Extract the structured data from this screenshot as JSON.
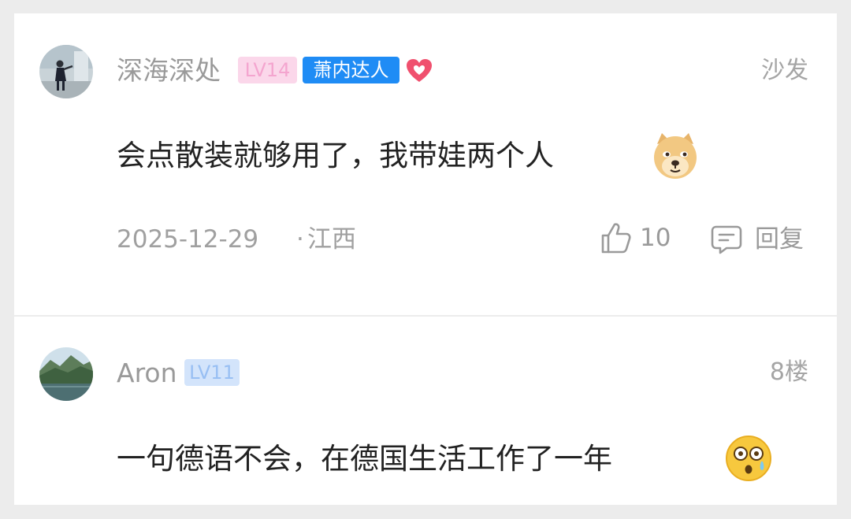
{
  "comments": [
    {
      "username": "深海深处",
      "level": "LV14",
      "tag": "萧内达人",
      "floor": "沙发",
      "text": "会点散装就够用了，我带娃两个人",
      "emoji_icon": "doge-emoji-icon",
      "date": "2025-12-29",
      "separator": "·",
      "location": "江西",
      "like_count": "10",
      "reply_label": "回复"
    },
    {
      "username": "Aron",
      "level": "LV11",
      "floor": "8楼",
      "text": "一句德语不会，在德国生活工作了一年",
      "emoji_icon": "shocked-face-emoji-icon"
    }
  ],
  "colors": {
    "background": "#ececec",
    "card": "#ffffff",
    "username": "#9a9a9a",
    "lv14_bg": "#fbd7ea",
    "lv14_text": "#f4a5cf",
    "lv11_bg": "#d3e4fb",
    "lv11_text": "#98bff3",
    "expert_badge": "#1f8cf5",
    "heart": "#f0506e",
    "meta_text": "#a0a0a0"
  }
}
